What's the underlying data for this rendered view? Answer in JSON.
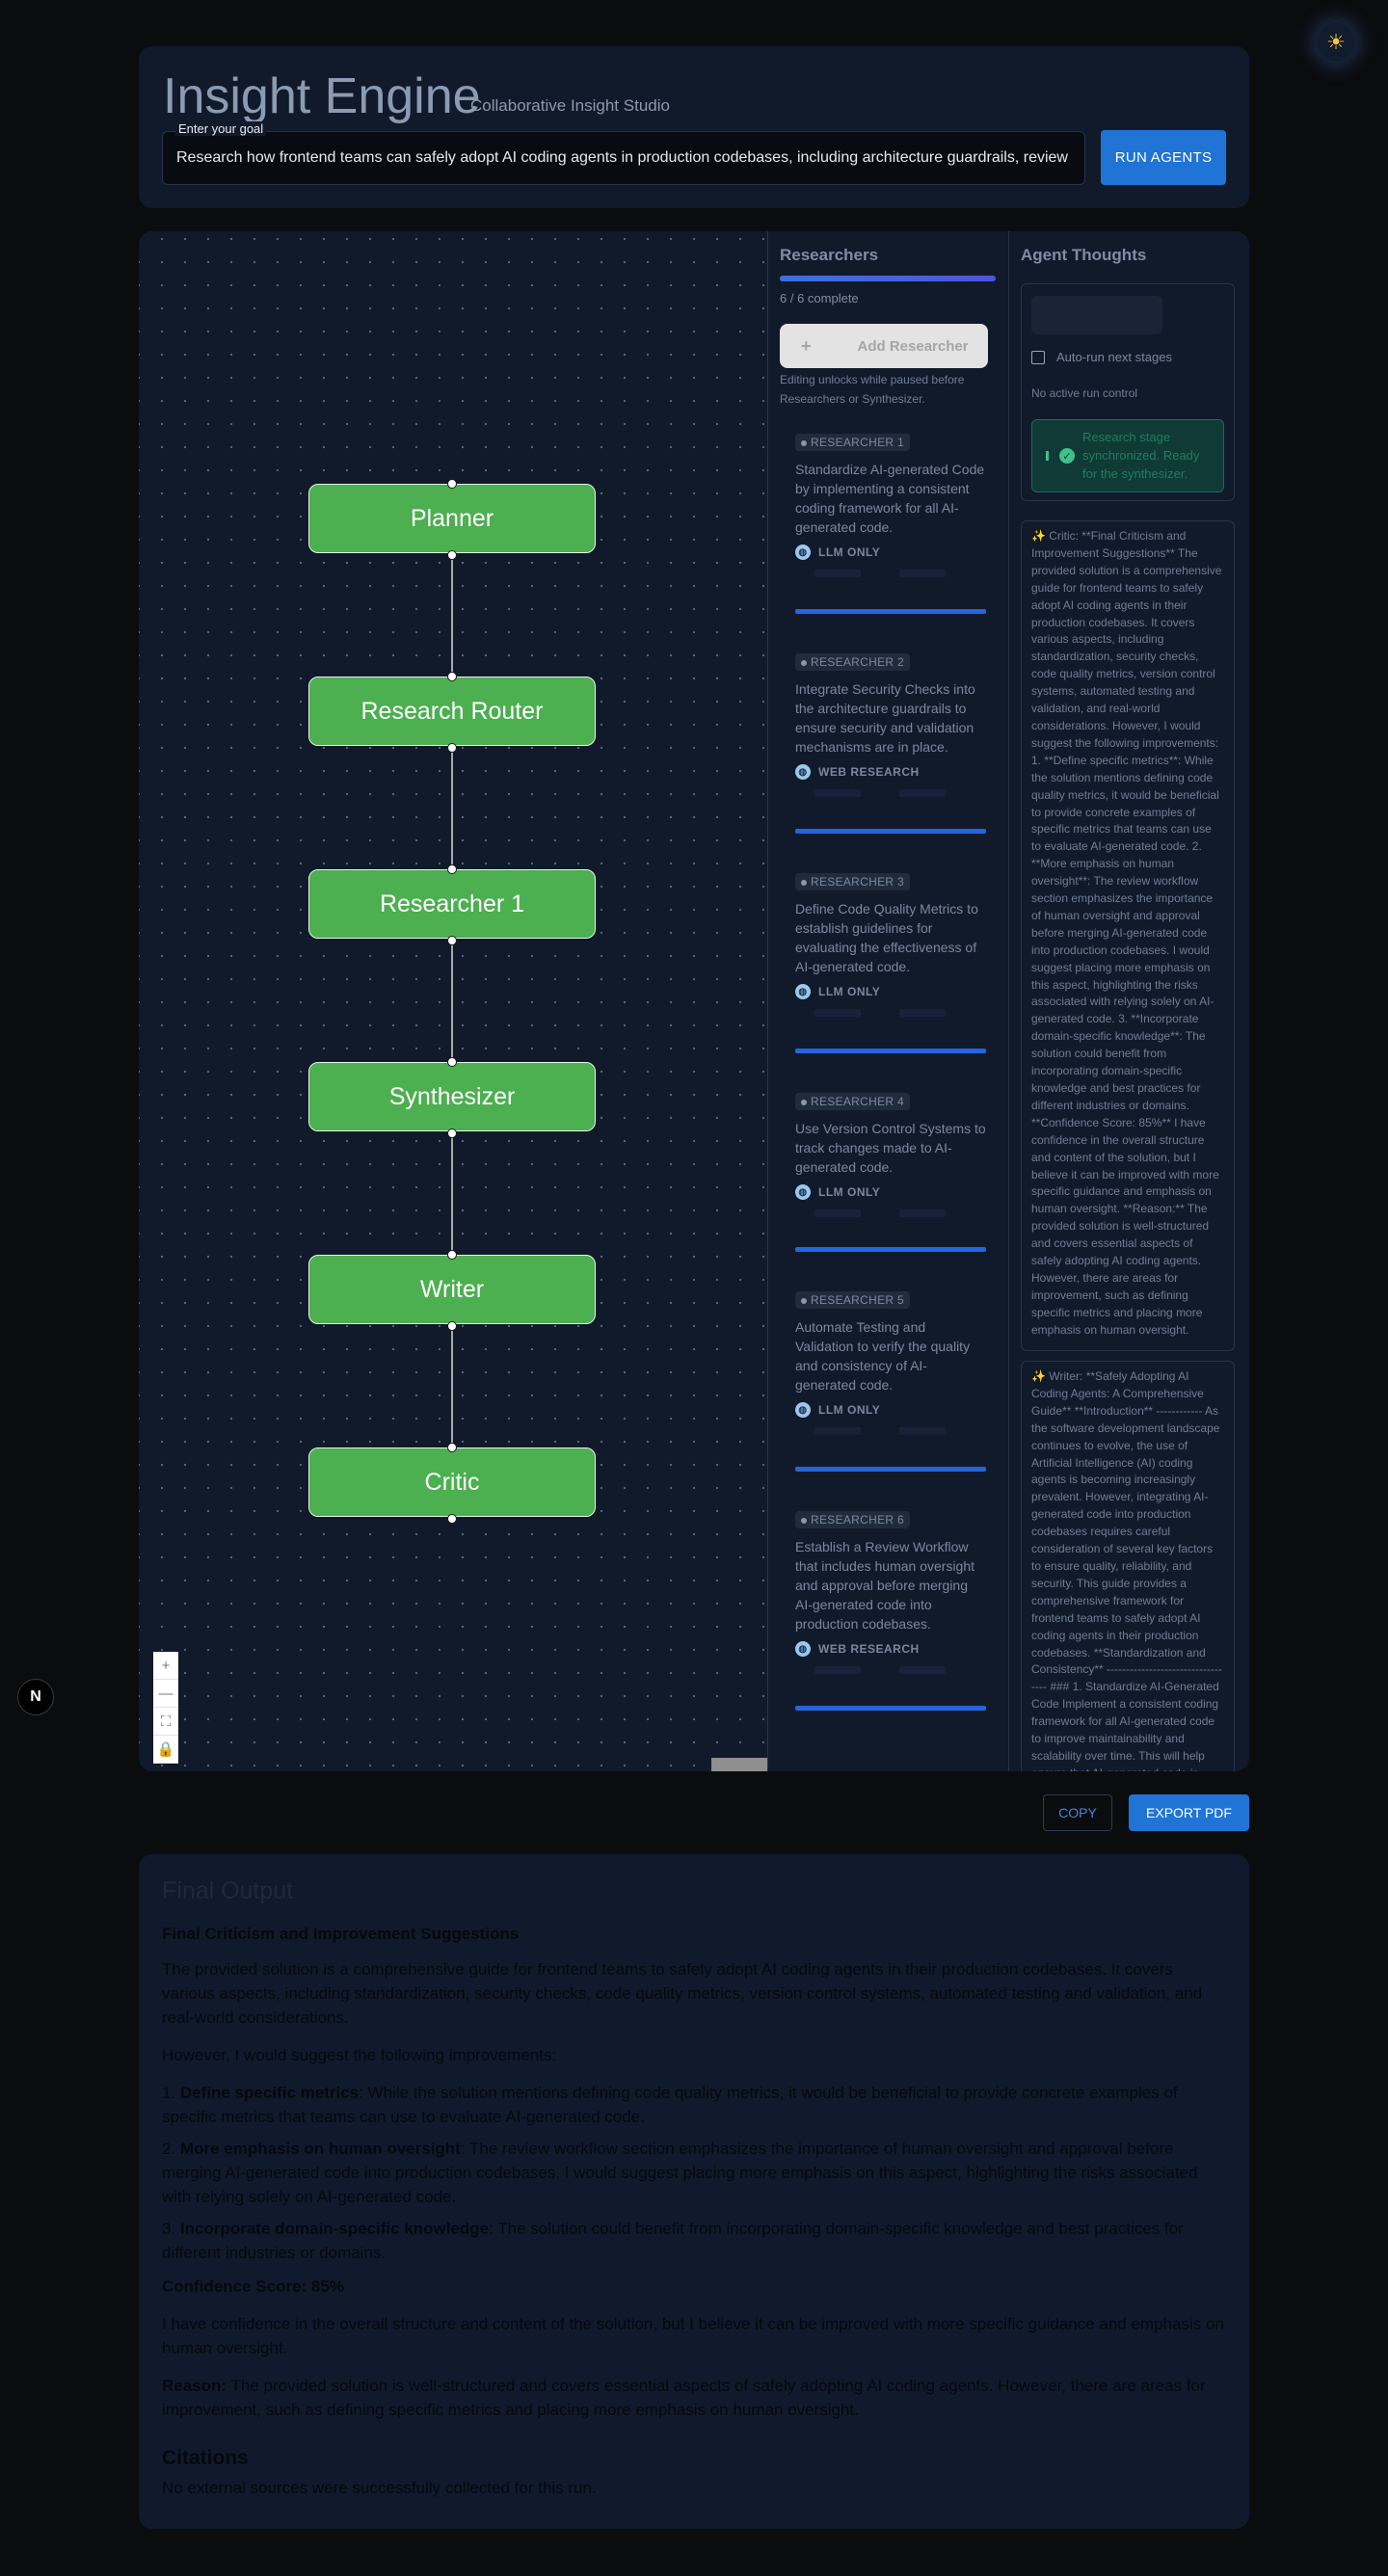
{
  "header": {
    "title": "Insight Engine",
    "subtitle": "Collaborative Insight Studio",
    "goal_label": "Enter your goal",
    "goal_value": "Research how frontend teams can safely adopt AI coding agents in production codebases, including architecture guardrails, review workflows, and quality metrics.",
    "run_button": "RUN AGENTS"
  },
  "theme_icon": "sun-icon",
  "flow": {
    "nodes": [
      "Planner",
      "Research Router",
      "Researcher 1",
      "Synthesizer",
      "Writer",
      "Critic"
    ],
    "controls": [
      "+",
      "—",
      "⛶",
      "🔒"
    ]
  },
  "researchers": {
    "title": "Researchers",
    "progress": 1.0,
    "progress_text": "6 / 6 complete",
    "add_button": "Add Researcher",
    "add_icon": "+",
    "edit_note": "Editing unlocks while paused before Researchers or Synthesizer.",
    "items": [
      {
        "badge": "RESEARCHER 1",
        "text": "Standardize AI-generated Code by implementing a consistent coding framework for all AI-generated code.",
        "mode": "LLM ONLY"
      },
      {
        "badge": "RESEARCHER 2",
        "text": "Integrate Security Checks into the architecture guardrails to ensure security and validation mechanisms are in place.",
        "mode": "WEB RESEARCH"
      },
      {
        "badge": "RESEARCHER 3",
        "text": "Define Code Quality Metrics to establish guidelines for evaluating the effectiveness of AI-generated code.",
        "mode": "LLM ONLY"
      },
      {
        "badge": "RESEARCHER 4",
        "text": "Use Version Control Systems to track changes made to AI-generated code.",
        "mode": "LLM ONLY"
      },
      {
        "badge": "RESEARCHER 5",
        "text": "Automate Testing and Validation to verify the quality and consistency of AI-generated code.",
        "mode": "LLM ONLY"
      },
      {
        "badge": "RESEARCHER 6",
        "text": "Establish a Review Workflow that includes human oversight and approval before merging AI-generated code into production codebases.",
        "mode": "WEB RESEARCH"
      }
    ]
  },
  "thoughts": {
    "title": "Agent Thoughts",
    "auto_run": "Auto-run next stages",
    "no_run": "No active run control",
    "sync_message": "Research stage synchronized. Ready for the synthesizer.",
    "critic": "✨ Critic: **Final Criticism and Improvement Suggestions** The provided solution is a comprehensive guide for frontend teams to safely adopt AI coding agents in their production codebases. It covers various aspects, including standardization, security checks, code quality metrics, version control systems, automated testing and validation, and real-world considerations. However, I would suggest the following improvements: 1. **Define specific metrics**: While the solution mentions defining code quality metrics, it would be beneficial to provide concrete examples of specific metrics that teams can use to evaluate AI-generated code. 2. **More emphasis on human oversight**: The review workflow section emphasizes the importance of human oversight and approval before merging AI-generated code into production codebases. I would suggest placing more emphasis on this aspect, highlighting the risks associated with relying solely on AI-generated code. 3. **Incorporate domain-specific knowledge**: The solution could benefit from incorporating domain-specific knowledge and best practices for different industries or domains. **Confidence Score: 85%** I have confidence in the overall structure and content of the solution, but I believe it can be improved with more specific guidance and emphasis on human oversight. **Reason:** The provided solution is well-structured and covers essential aspects of safely adopting AI coding agents. However, there are areas for improvement, such as defining specific metrics and placing more emphasis on human oversight.",
    "writer": "✨ Writer: **Safely Adopting AI Coding Agents: A Comprehensive Guide** **Introduction** ------------ As the software development landscape continues to evolve, the use of Artificial Intelligence (AI) coding agents is becoming increasingly prevalent. However, integrating AI-generated code into production codebases requires careful consideration of several key factors to ensure quality, reliability, and security. This guide provides a comprehensive framework for frontend teams to safely adopt AI coding agents in their production codebases. **Standardization and Consistency** ---------------------------------- ### 1. Standardize AI-Generated Code Implement a consistent coding framework for all AI-generated code to improve maintainability and scalability over time. This will help ensure that AI-generated code is"
  },
  "actions": {
    "copy": "COPY",
    "export": "EXPORT PDF"
  },
  "final": {
    "title": "Final Output",
    "heading": "Final Criticism and Improvement Suggestions",
    "intro": "The provided solution is a comprehensive guide for frontend teams to safely adopt AI coding agents in their production codebases. It covers various aspects, including standardization, security checks, code quality metrics, version control systems, automated testing and validation, and real-world considerations.",
    "lead": "However, I would suggest the following improvements:",
    "items": [
      {
        "label": "Define specific metrics",
        "text": ": While the solution mentions defining code quality metrics, it would be beneficial to provide concrete examples of specific metrics that teams can use to evaluate AI-generated code."
      },
      {
        "label": "More emphasis on human oversight",
        "text": ": The review workflow section emphasizes the importance of human oversight and approval before merging AI-generated code into production codebases. I would suggest placing more emphasis on this aspect, highlighting the risks associated with relying solely on AI-generated code."
      },
      {
        "label": "Incorporate domain-specific knowledge",
        "text": ": The solution could benefit from incorporating domain-specific knowledge and best practices for different industries or domains."
      }
    ],
    "confidence": "Confidence Score: 85%",
    "confidence_text": "I have confidence in the overall structure and content of the solution, but I believe it can be improved with more specific guidance and emphasis on human oversight.",
    "reason_label": "Reason:",
    "reason_text": " The provided solution is well-structured and covers essential aspects of safely adopting AI coding agents. However, there are areas for improvement, such as defining specific metrics and placing more emphasis on human oversight.",
    "citations_title": "Citations",
    "citations_text": "No external sources were successfully collected for this run."
  }
}
